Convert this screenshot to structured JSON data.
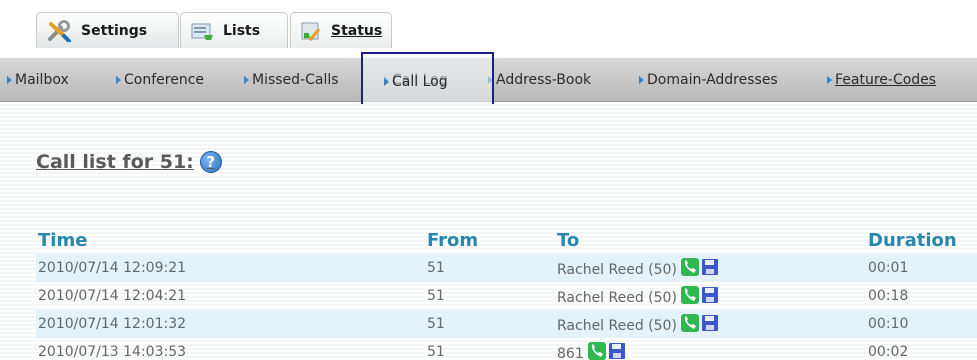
{
  "tabs": [
    {
      "label": "Settings",
      "icon": "tools-icon"
    },
    {
      "label": "Lists",
      "icon": "list-icon"
    },
    {
      "label": "Status",
      "icon": "status-icon"
    }
  ],
  "subnav": [
    {
      "label": "Mailbox"
    },
    {
      "label": "Conference"
    },
    {
      "label": "Missed-Calls"
    },
    {
      "label": "Call Log"
    },
    {
      "label": "Address-Book"
    },
    {
      "label": "Domain-Addresses"
    },
    {
      "label": "Feature-Codes"
    }
  ],
  "page": {
    "title": "Call list for 51:",
    "help_icon": "?"
  },
  "table": {
    "headers": {
      "time": "Time",
      "from": "From",
      "to": "To",
      "duration": "Duration"
    },
    "rows": [
      {
        "time": "2010/07/14 12:09:21",
        "from": "51",
        "to": "Rachel Reed (50)",
        "duration": "00:01"
      },
      {
        "time": "2010/07/14 12:04:21",
        "from": "51",
        "to": "Rachel Reed (50)",
        "duration": "00:18"
      },
      {
        "time": "2010/07/14 12:01:32",
        "from": "51",
        "to": "Rachel Reed (50)",
        "duration": "00:10"
      },
      {
        "time": "2010/07/13 14:03:53",
        "from": "51",
        "to": "861",
        "duration": "00:02"
      }
    ]
  },
  "colors": {
    "header_blue": "#2688b0",
    "row_alt": "#e4f2f9",
    "highlight_border": "#1c1f8a",
    "call_green": "#2fb84f"
  }
}
